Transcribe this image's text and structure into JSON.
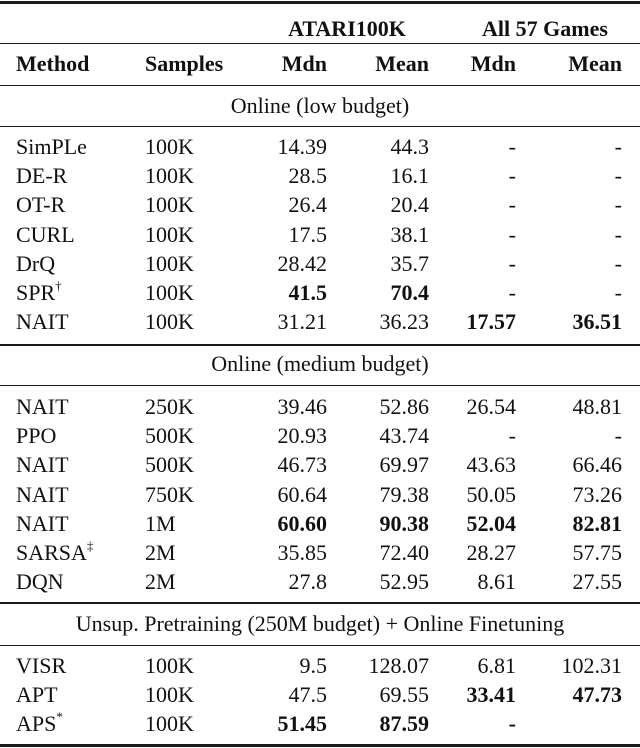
{
  "table": {
    "group_headers": {
      "atari": "ATARI100K",
      "all57": "All 57 Games"
    },
    "column_headers": {
      "method": "Method",
      "samples": "Samples",
      "atari_mdn": "Mdn",
      "atari_mean": "Mean",
      "all57_mdn": "Mdn",
      "all57_mean": "Mean"
    },
    "sections": [
      {
        "title": "Online (low budget)",
        "rows": [
          {
            "method": "SimPLe",
            "sup": "",
            "samples": "100K",
            "atari_mdn": "14.39",
            "atari_mean": "44.3",
            "all57_mdn": "-",
            "all57_mean": "-",
            "bold": []
          },
          {
            "method": "DE-R",
            "sup": "",
            "samples": "100K",
            "atari_mdn": "28.5",
            "atari_mean": "16.1",
            "all57_mdn": "-",
            "all57_mean": "-",
            "bold": []
          },
          {
            "method": "OT-R",
            "sup": "",
            "samples": "100K",
            "atari_mdn": "26.4",
            "atari_mean": "20.4",
            "all57_mdn": "-",
            "all57_mean": "-",
            "bold": []
          },
          {
            "method": "CURL",
            "sup": "",
            "samples": "100K",
            "atari_mdn": "17.5",
            "atari_mean": "38.1",
            "all57_mdn": "-",
            "all57_mean": "-",
            "bold": []
          },
          {
            "method": "DrQ",
            "sup": "",
            "samples": "100K",
            "atari_mdn": "28.42",
            "atari_mean": "35.7",
            "all57_mdn": "-",
            "all57_mean": "-",
            "bold": []
          },
          {
            "method": "SPR",
            "sup": "†",
            "samples": "100K",
            "atari_mdn": "41.5",
            "atari_mean": "70.4",
            "all57_mdn": "-",
            "all57_mean": "-",
            "bold": [
              "atari_mdn",
              "atari_mean"
            ]
          },
          {
            "method": "NAIT",
            "sup": "",
            "samples": "100K",
            "atari_mdn": "31.21",
            "atari_mean": "36.23",
            "all57_mdn": "17.57",
            "all57_mean": "36.51",
            "bold": [
              "all57_mdn",
              "all57_mean"
            ]
          }
        ]
      },
      {
        "title": "Online (medium budget)",
        "rows": [
          {
            "method": "NAIT",
            "sup": "",
            "samples": "250K",
            "atari_mdn": "39.46",
            "atari_mean": "52.86",
            "all57_mdn": "26.54",
            "all57_mean": "48.81",
            "bold": []
          },
          {
            "method": "PPO",
            "sup": "",
            "samples": "500K",
            "atari_mdn": "20.93",
            "atari_mean": "43.74",
            "all57_mdn": "-",
            "all57_mean": "-",
            "bold": []
          },
          {
            "method": "NAIT",
            "sup": "",
            "samples": "500K",
            "atari_mdn": "46.73",
            "atari_mean": "69.97",
            "all57_mdn": "43.63",
            "all57_mean": "66.46",
            "bold": []
          },
          {
            "method": "NAIT",
            "sup": "",
            "samples": "750K",
            "atari_mdn": "60.64",
            "atari_mean": "79.38",
            "all57_mdn": "50.05",
            "all57_mean": "73.26",
            "bold": []
          },
          {
            "method": "NAIT",
            "sup": "",
            "samples": "1M",
            "atari_mdn": "60.60",
            "atari_mean": "90.38",
            "all57_mdn": "52.04",
            "all57_mean": "82.81",
            "bold": [
              "atari_mdn",
              "atari_mean",
              "all57_mdn",
              "all57_mean"
            ]
          },
          {
            "method": "SARSA",
            "sup": "‡",
            "samples": "2M",
            "atari_mdn": "35.85",
            "atari_mean": "72.40",
            "all57_mdn": "28.27",
            "all57_mean": "57.75",
            "bold": []
          },
          {
            "method": "DQN",
            "sup": "",
            "samples": "2M",
            "atari_mdn": "27.8",
            "atari_mean": "52.95",
            "all57_mdn": "8.61",
            "all57_mean": "27.55",
            "bold": []
          }
        ]
      },
      {
        "title": "Unsup. Pretraining (250M budget) + Online Finetuning",
        "rows": [
          {
            "method": "VISR",
            "sup": "",
            "samples": "100K",
            "atari_mdn": "9.5",
            "atari_mean": "128.07",
            "all57_mdn": "6.81",
            "all57_mean": "102.31",
            "bold": []
          },
          {
            "method": "APT",
            "sup": "",
            "samples": "100K",
            "atari_mdn": "47.5",
            "atari_mean": "69.55",
            "all57_mdn": "33.41",
            "all57_mean": "47.73",
            "bold": [
              "all57_mdn",
              "all57_mean"
            ]
          },
          {
            "method": "APS",
            "sup": "*",
            "samples": "100K",
            "atari_mdn": "51.45",
            "atari_mean": "87.59",
            "all57_mdn": "-",
            "all57_mean": "",
            "bold": [
              "atari_mdn",
              "atari_mean",
              "all57_mdn"
            ]
          }
        ]
      }
    ]
  }
}
